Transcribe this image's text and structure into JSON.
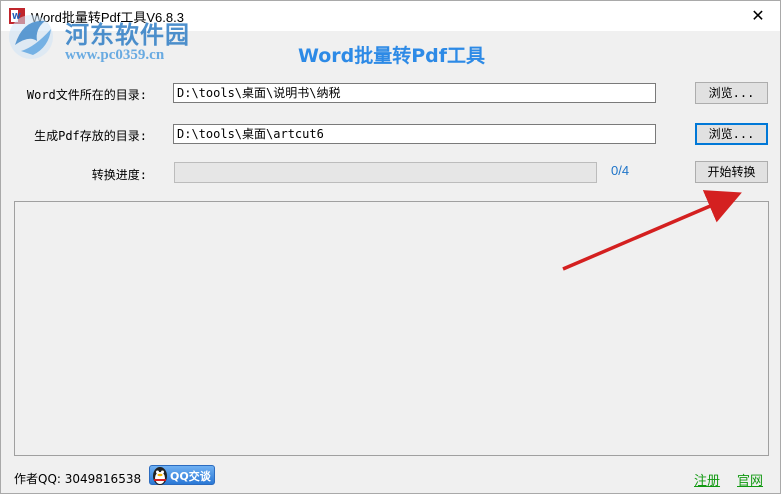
{
  "window": {
    "title": "Word批量转Pdf工具V6.8.3",
    "close_glyph": "✕"
  },
  "watermark": {
    "name": "河东软件园",
    "url": "www.pc0359.cn"
  },
  "app": {
    "heading": "Word批量转Pdf工具"
  },
  "form": {
    "source_dir": {
      "label": "Word文件所在的目录:",
      "value": "D:\\tools\\桌面\\说明书\\纳税",
      "browse_label": "浏览..."
    },
    "output_dir": {
      "label": "生成Pdf存放的目录:",
      "value": "D:\\tools\\桌面\\artcut6",
      "browse_label": "浏览..."
    },
    "progress": {
      "label": "转换进度:",
      "fraction": 0,
      "count_text": "0/4",
      "start_label": "开始转换"
    }
  },
  "footer": {
    "author_text": "作者QQ: 3049816538",
    "qq_badge_label": "QQ交谈",
    "register_label": "注册",
    "website_label": "官网"
  },
  "colors": {
    "heading": "#2d8ae6",
    "footer_link": "#119911",
    "arrow": "#d42020"
  }
}
